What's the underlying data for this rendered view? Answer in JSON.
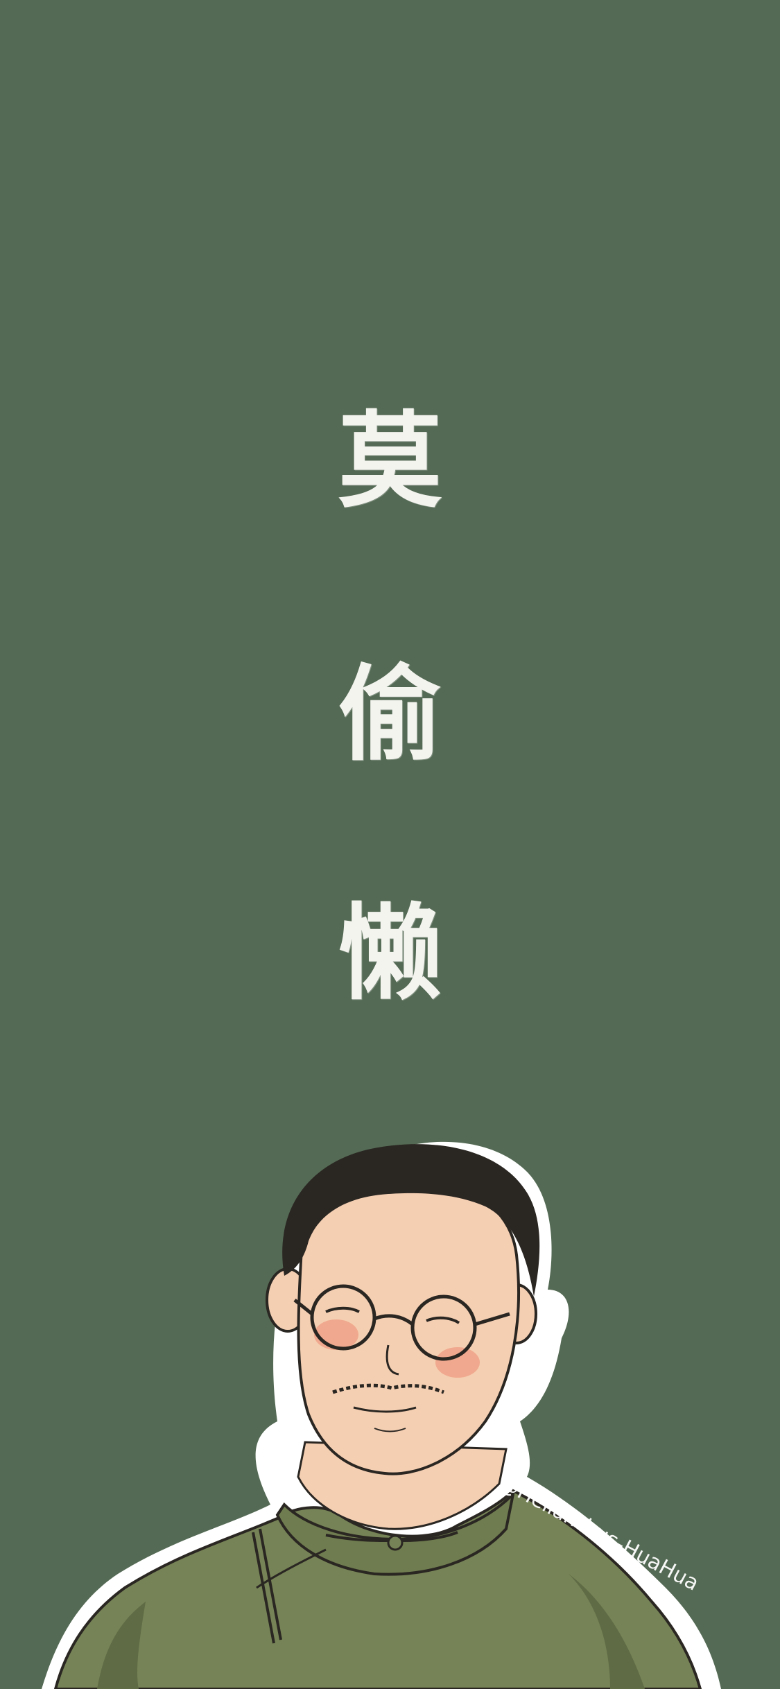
{
  "wallpaper": {
    "background_color": "#546a54",
    "motto": [
      "莫",
      "偷",
      "懒"
    ],
    "watermark": "@Helianthus-HuaHua",
    "illustration": {
      "subject": "cartoon man with round glasses in green mandarin-collar jacket",
      "colors": {
        "outline_sticker": "#ffffff",
        "hair": "#2a2622",
        "skin": "#f5cfb2",
        "cheek": "#f0a98e",
        "jacket": "#768356",
        "jacket_shadow": "#5f6b45"
      }
    }
  }
}
